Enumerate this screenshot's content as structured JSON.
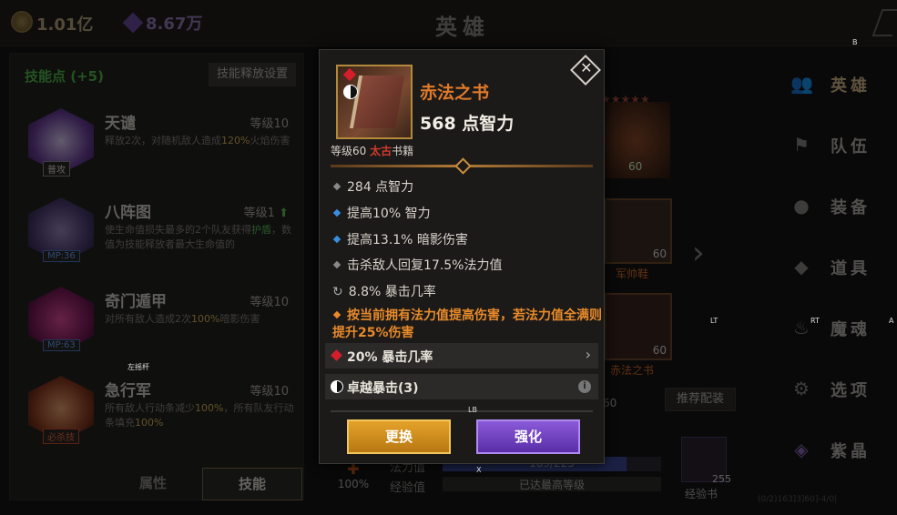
{
  "topbar": {
    "gold": "1.01亿",
    "gems": "8.67万",
    "title": "英雄"
  },
  "left": {
    "header": "技能点 (+5)",
    "cast_button": "技能释放设置",
    "skills": [
      {
        "name": "天谴",
        "level": "等级10",
        "tag": "普攻",
        "desc_a": "释放2次，对随机敌人造成",
        "desc_hl": "120%",
        "desc_b": "火焰伤害"
      },
      {
        "name": "八阵图",
        "level": "等级1",
        "tag": "MP:36",
        "desc_a": "使生命值损失最多的2个队友获得",
        "desc_hl": "护盾",
        "desc_b": "，数值为技能释放者最大生命值的"
      },
      {
        "name": "奇门遁甲",
        "level": "等级10",
        "tag": "MP:63",
        "desc_a": "对所有敌人造成2次",
        "desc_hl": "100%",
        "desc_b": "暗影伤害"
      },
      {
        "name": "急行军",
        "level": "等级10",
        "tag": "必杀技",
        "desc_a": "所有敌人行动条减少",
        "desc_hl": "100%",
        "desc_b": "，所有队友行动条填充",
        "desc_hl2": "100%"
      }
    ],
    "tabs": [
      "属性",
      "技能"
    ]
  },
  "middle": {
    "level": "60",
    "boots": "军帅鞋",
    "book": "赤法之书",
    "slot_level": "60",
    "recommend": "推荐配装",
    "mana_label": "法力值",
    "mana_value": "189/225",
    "exp_label": "经验值",
    "exp_value": "已达最高等级",
    "percent": "100%",
    "exp_book": "经验书",
    "exp_count": "255",
    "small_60": "60",
    "tiny_text": "(0/2)163]3]60]-4/0| "
  },
  "right": {
    "nav": [
      "英雄",
      "队伍",
      "装备",
      "道具",
      "魔魂",
      "选项",
      "紫晶"
    ]
  },
  "hints": {
    "b": "B",
    "lt": "LT",
    "rt": "RT",
    "a": "A",
    "lb": "LB",
    "x": "X",
    "stick": "左摇杆"
  },
  "popup": {
    "name": "赤法之书",
    "main_stat": "568 点智力",
    "level_prefix": "等级60",
    "rarity": "太古",
    "type": "书籍",
    "attrs": [
      "284 点智力",
      "提高10% 智力",
      "提高13.1% 暗影伤害",
      "击杀敌人回复17.5%法力值",
      "8.8% 暴击几率"
    ],
    "special": "按当前拥有法力值提高伤害，若法力值全满则提升25%伤害",
    "gem_line": "20% 暴击几率",
    "taiji_line": "卓越暴击(3)",
    "btn_replace": "更换",
    "btn_enhance": "强化"
  },
  "colors": {
    "accent_orange": "#e07a2a",
    "rarity_red": "#d33b2c",
    "green": "#5bc05a"
  }
}
